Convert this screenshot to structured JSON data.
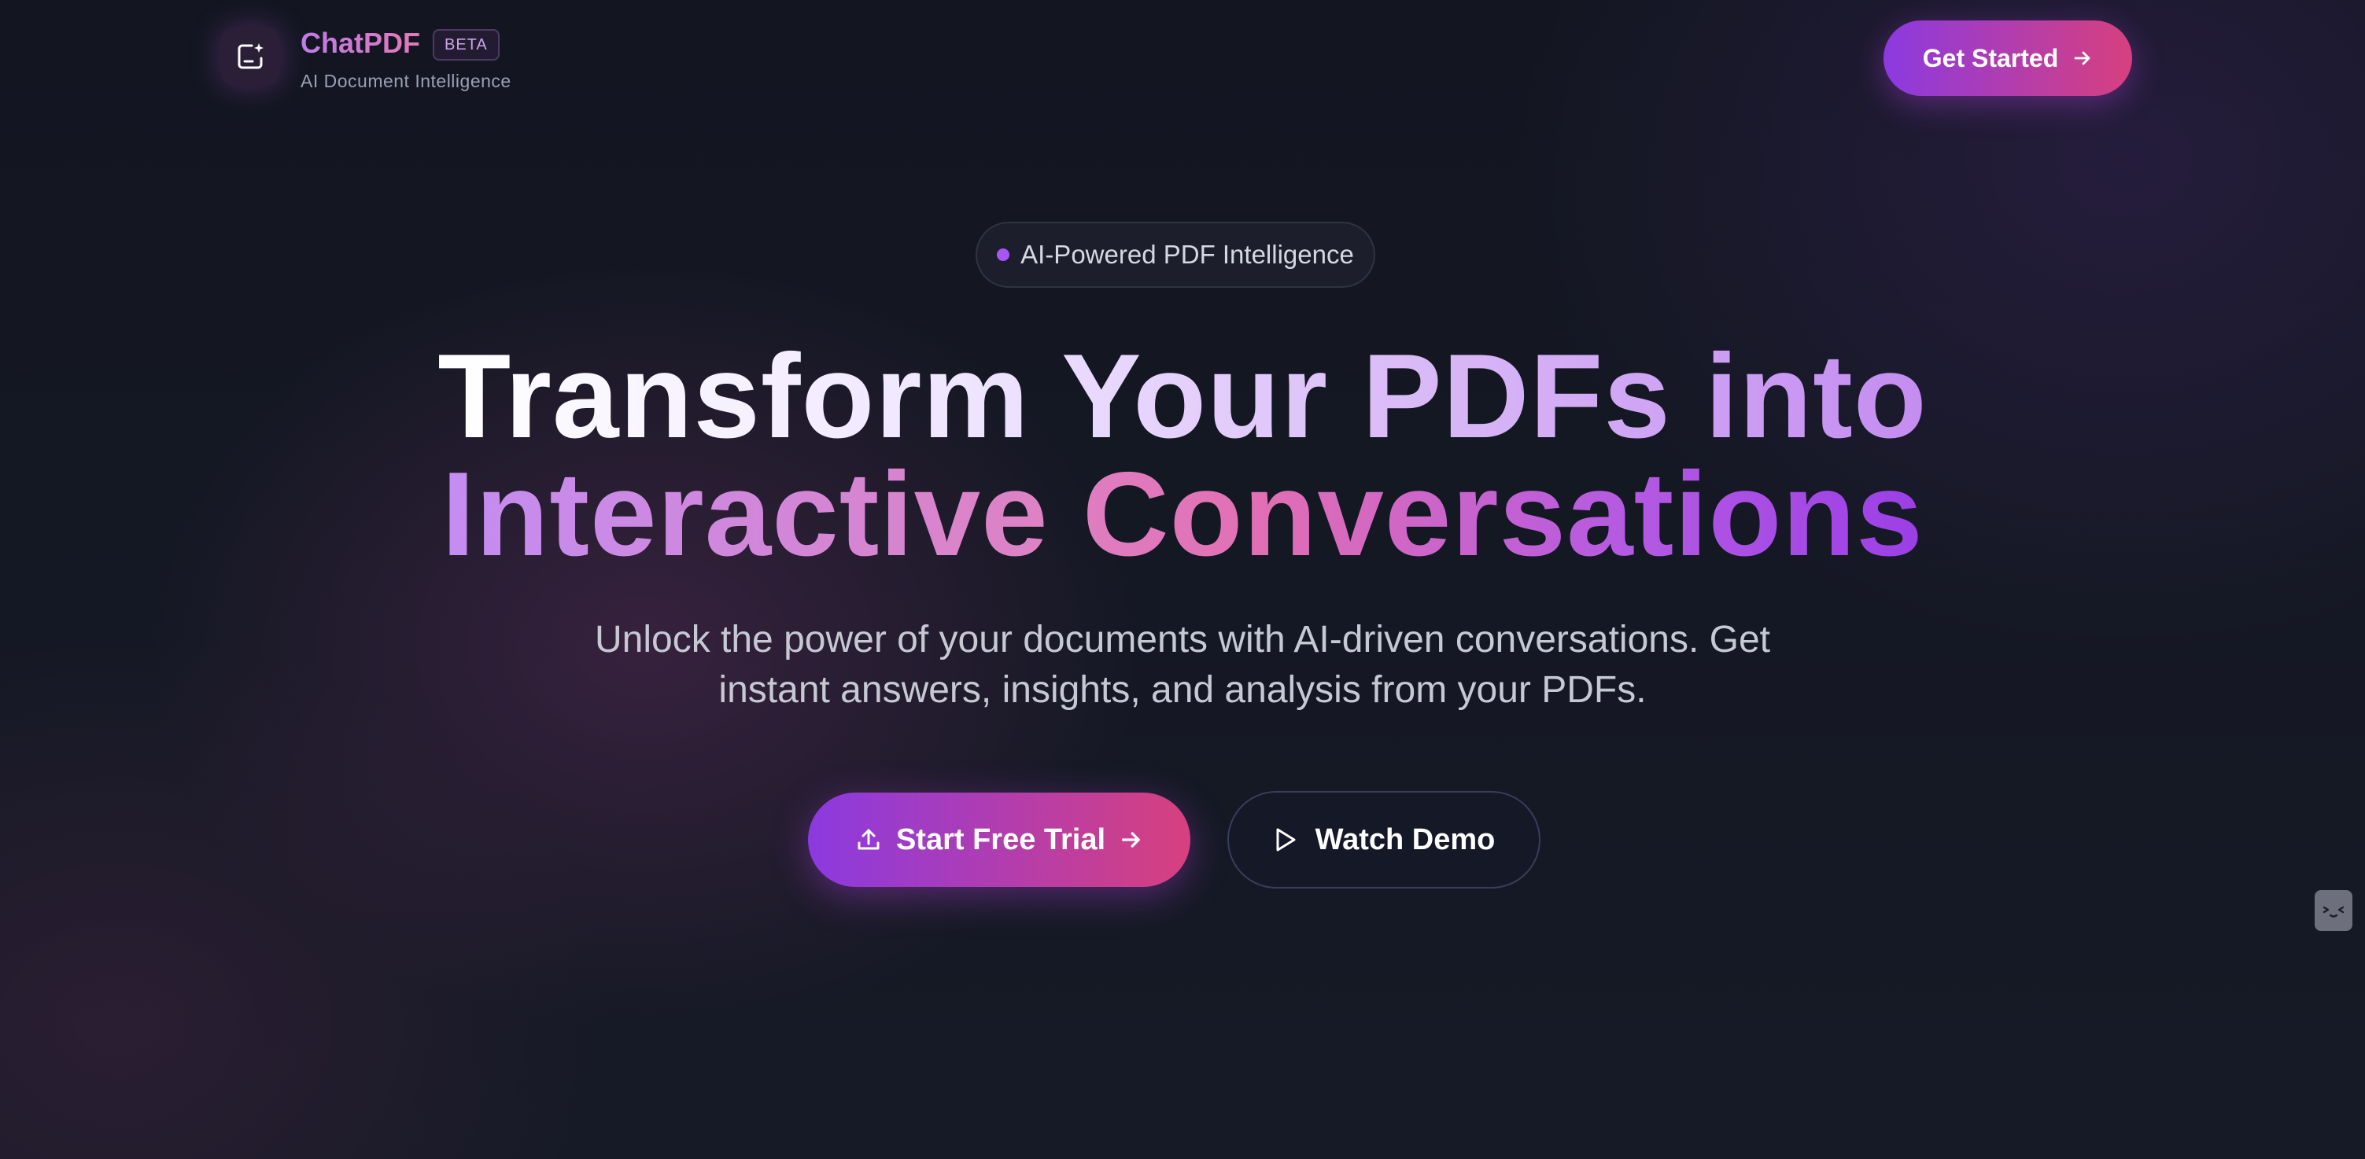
{
  "header": {
    "brand_name": "ChatPDF",
    "beta_badge": "BETA",
    "tagline": "AI Document Intelligence",
    "get_started_label": "Get Started"
  },
  "hero": {
    "pill_text": "AI-Powered PDF Intelligence",
    "headline_line1": "Transform Your PDFs into",
    "headline_line2": "Interactive Conversations",
    "subtitle_line1": "Unlock the power of your documents with AI-driven conversations. Get",
    "subtitle_line2": "instant answers, insights, and analysis from your PDFs.",
    "primary_cta_label": "Start Free Trial",
    "secondary_cta_label": "Watch Demo"
  },
  "icons": {
    "logo": "message-sparkle-icon",
    "get_started": "arrow-right-icon",
    "primary_cta_leading": "upload-icon",
    "primary_cta_trailing": "arrow-right-icon",
    "secondary_cta": "play-icon",
    "widget": "face-icon"
  },
  "colors": {
    "accent_purple": "#8b3ae0",
    "accent_pink": "#d7407e",
    "background": "#141722"
  }
}
